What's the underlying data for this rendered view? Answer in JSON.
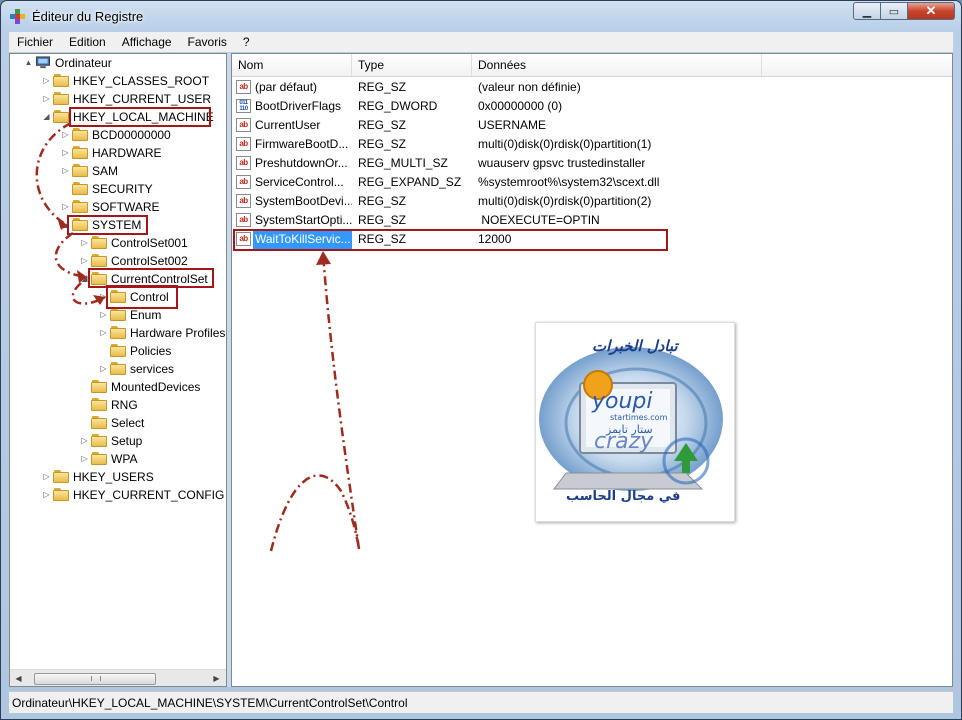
{
  "window": {
    "title": "Éditeur du Registre",
    "close_glyph": "✕",
    "min_glyph": "▁",
    "max_glyph": "▭"
  },
  "menu": [
    "Fichier",
    "Edition",
    "Affichage",
    "Favoris",
    "?"
  ],
  "tree": [
    {
      "label": "Ordinateur",
      "depth": 0,
      "exp": "▲",
      "icon": "computer-icon"
    },
    {
      "label": "HKEY_CLASSES_ROOT",
      "depth": 1,
      "exp": "▷"
    },
    {
      "label": "HKEY_CURRENT_USER",
      "depth": 1,
      "exp": "▷"
    },
    {
      "label": "HKEY_LOCAL_MACHINE",
      "depth": 1,
      "exp": "◢",
      "highlight": true
    },
    {
      "label": "BCD00000000",
      "depth": 2,
      "exp": "▷"
    },
    {
      "label": "HARDWARE",
      "depth": 2,
      "exp": "▷"
    },
    {
      "label": "SAM",
      "depth": 2,
      "exp": "▷"
    },
    {
      "label": "SECURITY",
      "depth": 2,
      "exp": ""
    },
    {
      "label": "SOFTWARE",
      "depth": 2,
      "exp": "▷"
    },
    {
      "label": "SYSTEM",
      "depth": 2,
      "exp": "◢",
      "highlight": true
    },
    {
      "label": "ControlSet001",
      "depth": 3,
      "exp": "▷"
    },
    {
      "label": "ControlSet002",
      "depth": 3,
      "exp": "▷"
    },
    {
      "label": "CurrentControlSet",
      "depth": 3,
      "exp": "◢",
      "highlight": true
    },
    {
      "label": "Control",
      "depth": 4,
      "exp": "▷",
      "highlight": true
    },
    {
      "label": "Enum",
      "depth": 4,
      "exp": "▷"
    },
    {
      "label": "Hardware Profiles",
      "depth": 4,
      "exp": "▷"
    },
    {
      "label": "Policies",
      "depth": 4,
      "exp": ""
    },
    {
      "label": "services",
      "depth": 4,
      "exp": "▷"
    },
    {
      "label": "MountedDevices",
      "depth": 3,
      "exp": ""
    },
    {
      "label": "RNG",
      "depth": 3,
      "exp": ""
    },
    {
      "label": "Select",
      "depth": 3,
      "exp": ""
    },
    {
      "label": "Setup",
      "depth": 3,
      "exp": "▷"
    },
    {
      "label": "WPA",
      "depth": 3,
      "exp": "▷"
    },
    {
      "label": "HKEY_USERS",
      "depth": 1,
      "exp": "▷"
    },
    {
      "label": "HKEY_CURRENT_CONFIG",
      "depth": 1,
      "exp": "▷"
    }
  ],
  "list": {
    "columns": [
      "Nom",
      "Type",
      "Données"
    ],
    "rows": [
      {
        "name": "(par défaut)",
        "type": "REG_SZ",
        "data": "(valeur non définie)",
        "icon": "ab"
      },
      {
        "name": "BootDriverFlags",
        "type": "REG_DWORD",
        "data": "0x00000000 (0)",
        "icon": "bin"
      },
      {
        "name": "CurrentUser",
        "type": "REG_SZ",
        "data": "USERNAME",
        "icon": "ab"
      },
      {
        "name": "FirmwareBootD...",
        "type": "REG_SZ",
        "data": "multi(0)disk(0)rdisk(0)partition(1)",
        "icon": "ab"
      },
      {
        "name": "PreshutdownOr...",
        "type": "REG_MULTI_SZ",
        "data": "wuauserv gpsvc trustedinstaller",
        "icon": "ab"
      },
      {
        "name": "ServiceControl...",
        "type": "REG_EXPAND_SZ",
        "data": "%systemroot%\\system32\\scext.dll",
        "icon": "ab"
      },
      {
        "name": "SystemBootDevi...",
        "type": "REG_SZ",
        "data": "multi(0)disk(0)rdisk(0)partition(2)",
        "icon": "ab"
      },
      {
        "name": "SystemStartOpti...",
        "type": "REG_SZ",
        "data": " NOEXECUTE=OPTIN",
        "icon": "ab"
      },
      {
        "name": "WaitToKillServic...",
        "type": "REG_SZ",
        "data": "12000",
        "icon": "ab",
        "selected": true
      }
    ]
  },
  "statusbar": {
    "path": "Ordinateur\\HKEY_LOCAL_MACHINE\\SYSTEM\\CurrentControlSet\\Control"
  },
  "logo": {
    "arabic_top": "تبادل الخبرات",
    "brand": "youpi",
    "site": "startimes.com",
    "arabic_mid": "ستار تايمز",
    "crazy": "crazy",
    "arabic_bottom": "في مجال الحاسب"
  },
  "colors": {
    "highlight": "#a5161a",
    "selection": "#3399ff",
    "arrow": "#9e2b1d"
  }
}
